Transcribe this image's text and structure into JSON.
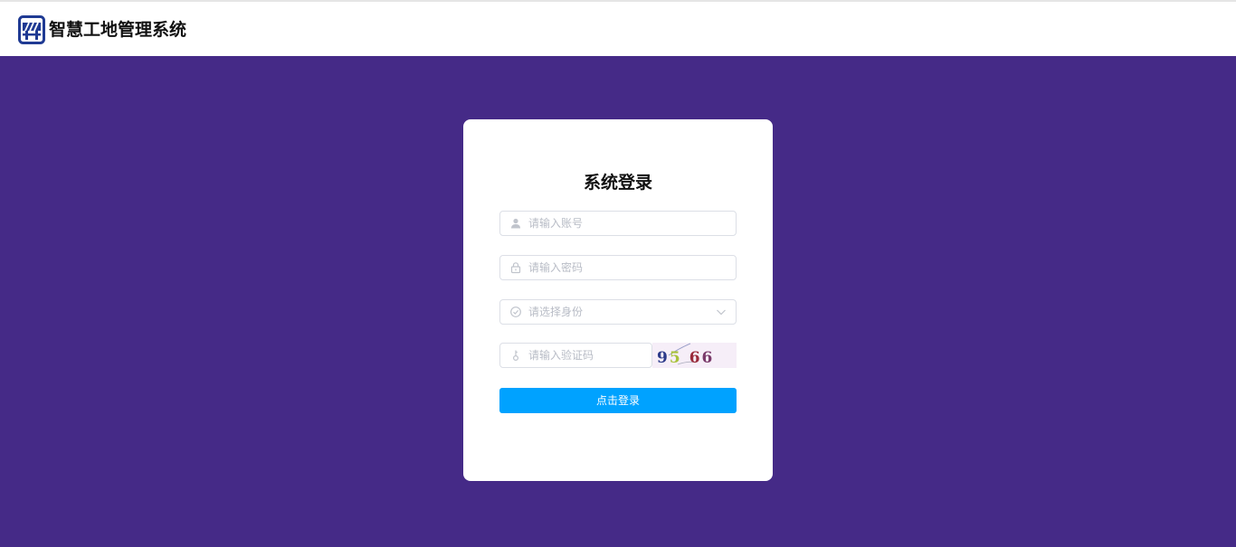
{
  "header": {
    "app_title": "智慧工地管理系统",
    "logo_icon": "construction-barrier-icon"
  },
  "login": {
    "title": "系统登录",
    "account": {
      "placeholder": "请输入账号",
      "icon": "user-icon"
    },
    "password": {
      "placeholder": "请输入密码",
      "icon": "lock-icon"
    },
    "role": {
      "placeholder": "请选择身份",
      "icon": "check-circle-icon"
    },
    "captcha": {
      "placeholder": "请输入验证码",
      "icon": "key-icon",
      "code": "9566"
    },
    "submit_label": "点击登录"
  },
  "colors": {
    "background": "#452a87",
    "primary": "#00a2ff",
    "logo": "#1f3a93"
  }
}
